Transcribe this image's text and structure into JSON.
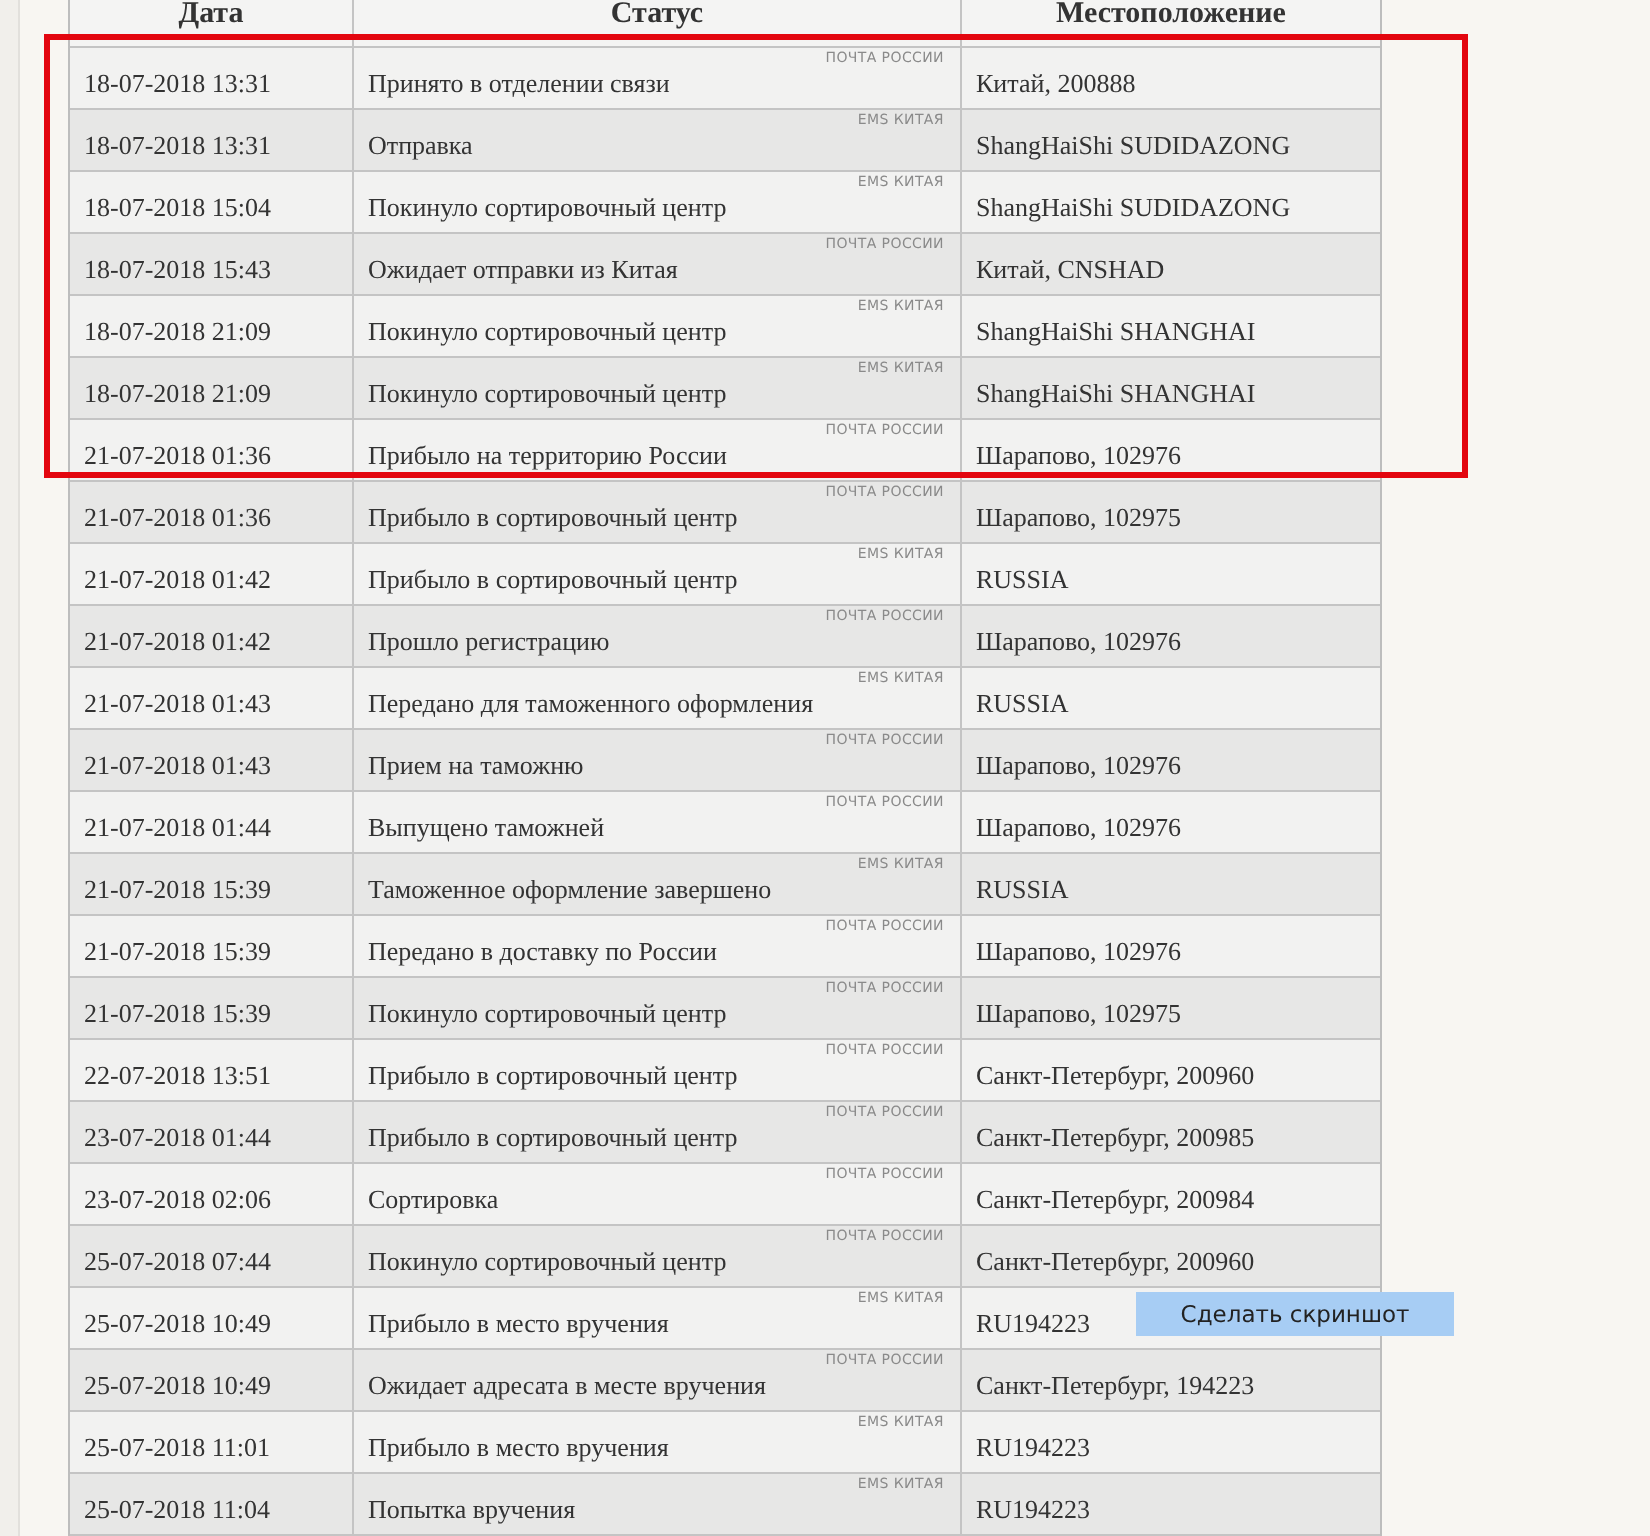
{
  "table": {
    "columns": [
      "Дата",
      "Статус",
      "Местоположение"
    ],
    "rows": [
      {
        "date": "18-07-2018 13:31",
        "status": "Принято в отделении связи",
        "source": "ПОЧТА РОССИИ",
        "location": "Китай, 200888"
      },
      {
        "date": "18-07-2018 13:31",
        "status": "Отправка",
        "source": "EMS КИТАЯ",
        "location": "ShangHaiShi SUDIDAZONG"
      },
      {
        "date": "18-07-2018 15:04",
        "status": "Покинуло сортировочный центр",
        "source": "EMS КИТАЯ",
        "location": "ShangHaiShi SUDIDAZONG"
      },
      {
        "date": "18-07-2018 15:43",
        "status": "Ожидает отправки из Китая",
        "source": "ПОЧТА РОССИИ",
        "location": "Китай, CNSHAD"
      },
      {
        "date": "18-07-2018 21:09",
        "status": "Покинуло сортировочный центр",
        "source": "EMS КИТАЯ",
        "location": "ShangHaiShi SHANGHAI"
      },
      {
        "date": "18-07-2018 21:09",
        "status": "Покинуло сортировочный центр",
        "source": "EMS КИТАЯ",
        "location": "ShangHaiShi SHANGHAI"
      },
      {
        "date": "21-07-2018 01:36",
        "status": "Прибыло на территорию России",
        "source": "ПОЧТА РОССИИ",
        "location": "Шарапово, 102976"
      },
      {
        "date": "21-07-2018 01:36",
        "status": "Прибыло в сортировочный центр",
        "source": "ПОЧТА РОССИИ",
        "location": "Шарапово, 102975"
      },
      {
        "date": "21-07-2018 01:42",
        "status": "Прибыло в сортировочный центр",
        "source": "EMS КИТАЯ",
        "location": "RUSSIA"
      },
      {
        "date": "21-07-2018 01:42",
        "status": "Прошло регистрацию",
        "source": "ПОЧТА РОССИИ",
        "location": "Шарапово, 102976"
      },
      {
        "date": "21-07-2018 01:43",
        "status": "Передано для таможенного оформления",
        "source": "EMS КИТАЯ",
        "location": "RUSSIA"
      },
      {
        "date": "21-07-2018 01:43",
        "status": "Прием на таможню",
        "source": "ПОЧТА РОССИИ",
        "location": "Шарапово, 102976"
      },
      {
        "date": "21-07-2018 01:44",
        "status": "Выпущено таможней",
        "source": "ПОЧТА РОССИИ",
        "location": "Шарапово, 102976"
      },
      {
        "date": "21-07-2018 15:39",
        "status": "Таможенное оформление завершено",
        "source": "EMS КИТАЯ",
        "location": "RUSSIA"
      },
      {
        "date": "21-07-2018 15:39",
        "status": "Передано в доставку по России",
        "source": "ПОЧТА РОССИИ",
        "location": "Шарапово, 102976"
      },
      {
        "date": "21-07-2018 15:39",
        "status": "Покинуло сортировочный центр",
        "source": "ПОЧТА РОССИИ",
        "location": "Шарапово, 102975"
      },
      {
        "date": "22-07-2018 13:51",
        "status": "Прибыло в сортировочный центр",
        "source": "ПОЧТА РОССИИ",
        "location": "Санкт-Петербург, 200960"
      },
      {
        "date": "23-07-2018 01:44",
        "status": "Прибыло в сортировочный центр",
        "source": "ПОЧТА РОССИИ",
        "location": "Санкт-Петербург, 200985"
      },
      {
        "date": "23-07-2018 02:06",
        "status": "Сортировка",
        "source": "ПОЧТА РОССИИ",
        "location": "Санкт-Петербург, 200984"
      },
      {
        "date": "25-07-2018 07:44",
        "status": "Покинуло сортировочный центр",
        "source": "ПОЧТА РОССИИ",
        "location": "Санкт-Петербург, 200960"
      },
      {
        "date": "25-07-2018 10:49",
        "status": "Прибыло в место вручения",
        "source": "EMS КИТАЯ",
        "location": "RU194223"
      },
      {
        "date": "25-07-2018 10:49",
        "status": "Ожидает адресата в месте вручения",
        "source": "ПОЧТА РОССИИ",
        "location": "Санкт-Петербург, 194223"
      },
      {
        "date": "25-07-2018 11:01",
        "status": "Прибыло в место вручения",
        "source": "EMS КИТАЯ",
        "location": "RU194223"
      },
      {
        "date": "25-07-2018 11:04",
        "status": "Попытка вручения",
        "source": "EMS КИТАЯ",
        "location": "RU194223"
      }
    ]
  },
  "tooltip": {
    "text": "Сделать скриншот"
  }
}
